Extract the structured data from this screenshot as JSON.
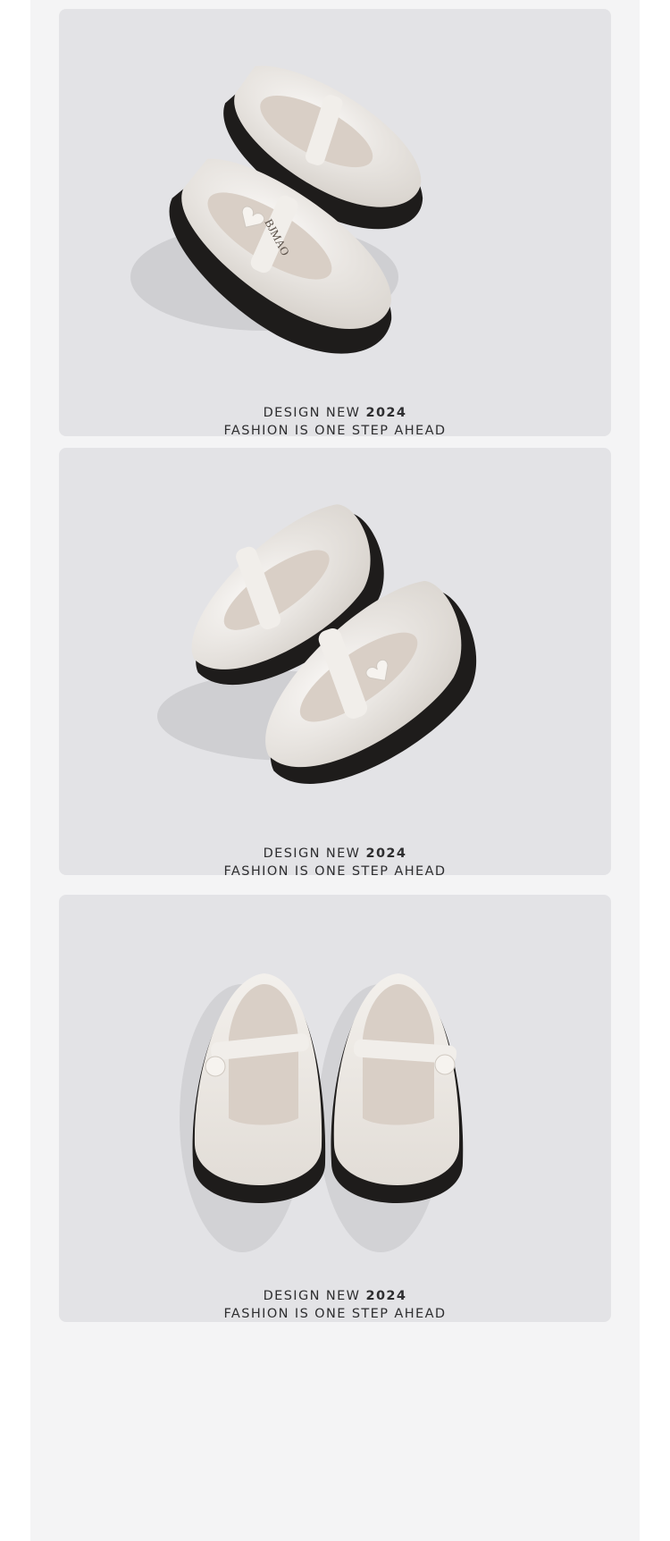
{
  "sections": [
    {
      "image_name": "mary-jane-shoes-top-view",
      "caption": {
        "design": "DESIGN NEW",
        "year": "2024",
        "tagline": "FASHION IS ONE STEP AHEAD"
      }
    },
    {
      "image_name": "mary-jane-shoes-side-view",
      "caption": {
        "design": "DESIGN NEW",
        "year": "2024",
        "tagline": "FASHION IS ONE STEP AHEAD"
      }
    },
    {
      "image_name": "mary-jane-shoes-front-view",
      "caption": {
        "design": "DESIGN NEW",
        "year": "2024",
        "tagline": "FASHION IS ONE STEP AHEAD"
      }
    }
  ],
  "brand_mark": "BJMAO",
  "colors": {
    "page_bg": "#f4f4f5",
    "panel_bg": "#e3e3e6",
    "shoe_upper": "#ece8e3",
    "shoe_sole": "#1e1c1b",
    "insole": "#d9cfc6",
    "caption_text": "#2e2e30"
  }
}
